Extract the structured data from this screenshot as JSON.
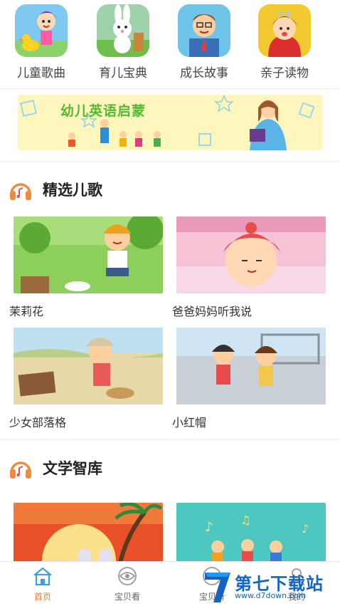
{
  "categories": [
    {
      "label": "儿童歌曲",
      "icon": "duck-girl-icon"
    },
    {
      "label": "育儿宝典",
      "icon": "rabbit-icon"
    },
    {
      "label": "成长故事",
      "icon": "teacher-icon"
    },
    {
      "label": "亲子读物",
      "icon": "princess-icon"
    }
  ],
  "banner": {
    "title": "幼儿英语启蒙"
  },
  "sections": {
    "songs": {
      "title": "精选儿歌",
      "icon": "headphones-icon",
      "items": [
        {
          "caption": "茉莉花"
        },
        {
          "caption": "爸爸妈妈听我说"
        },
        {
          "caption": "少女部落格"
        },
        {
          "caption": "小红帽"
        }
      ]
    },
    "literature": {
      "title": "文学智库",
      "icon": "headphones-icon"
    }
  },
  "nav": {
    "items": [
      {
        "label": "首页",
        "icon": "home-icon",
        "active": true
      },
      {
        "label": "宝贝看",
        "icon": "eye-icon",
        "active": false
      },
      {
        "label": "宝贝听",
        "icon": "headset-icon",
        "active": false
      },
      {
        "label": "我的",
        "icon": "user-icon",
        "active": false
      }
    ]
  },
  "watermark": {
    "title": "第七下载站",
    "url": "www.d7down.com"
  },
  "colors": {
    "accent": "#ee7a2c",
    "headphone": "#f08a3c",
    "watermark": "#1565c0"
  }
}
